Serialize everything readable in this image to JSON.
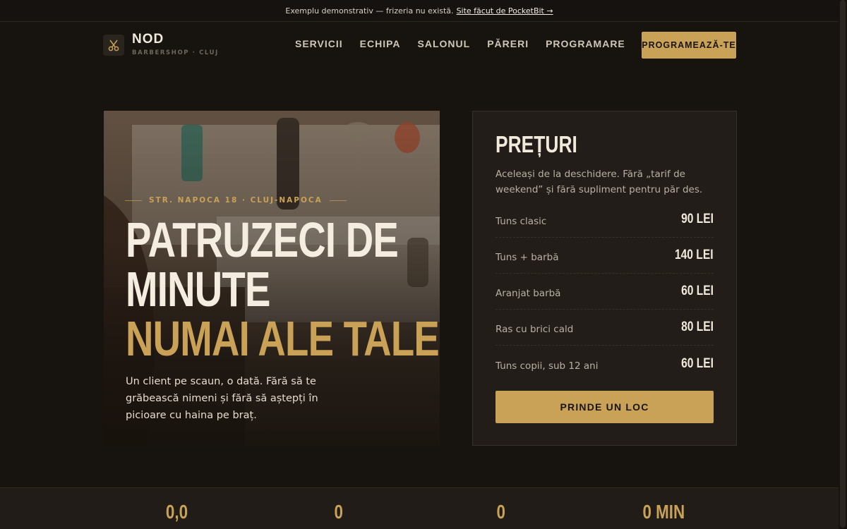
{
  "notice": {
    "text": "Exemplu demonstrativ — frizeria nu există.",
    "link": "Site făcut de PocketBit →"
  },
  "brand": {
    "name": "NOD",
    "tagline": "BARBERSHOP · CLUJ",
    "logo_icon": "scissors-icon"
  },
  "nav": {
    "items": [
      {
        "label": "SERVICII"
      },
      {
        "label": "ECHIPA"
      },
      {
        "label": "SALONUL"
      },
      {
        "label": "PĂRERI"
      },
      {
        "label": "PROGRAMARE"
      }
    ],
    "cta": "PROGRAMEAZĂ-TE"
  },
  "hero": {
    "kicker": "STR. NAPOCA 18 · CLUJ-NAPOCA",
    "title_line1": "PATRUZECI DE",
    "title_line2": "MINUTE",
    "title_line3": "NUMAI ALE TALE.",
    "description": "Un client pe scaun, o dată. Fără să te grăbească nimeni și fără să aștepți în picioare cu haina pe braț."
  },
  "pricing": {
    "title": "PREȚURI",
    "description": "Aceleași de la deschidere. Fără „tarif de weekend” și fără supliment pentru păr des.",
    "items": [
      {
        "name": "Tuns clasic",
        "price": "90 LEI"
      },
      {
        "name": "Tuns + barbă",
        "price": "140 LEI"
      },
      {
        "name": "Aranjat barbă",
        "price": "60 LEI"
      },
      {
        "name": "Ras cu brici cald",
        "price": "80 LEI"
      },
      {
        "name": "Tuns copii, sub 12 ani",
        "price": "60 LEI"
      }
    ],
    "cta": "PRINDE UN LOC"
  },
  "stats": [
    {
      "value": "0,0"
    },
    {
      "value": "0"
    },
    {
      "value": "0"
    },
    {
      "value": "0 MIN"
    }
  ],
  "colors": {
    "accent": "#c9a157",
    "background": "#17130f",
    "card": "#221d18"
  }
}
